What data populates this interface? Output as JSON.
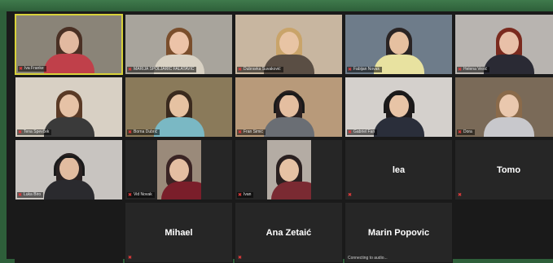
{
  "participants": [
    {
      "name": "Iva Franke",
      "type": "video",
      "active": true,
      "bg": "#8a8478",
      "skin": "#e2b9a0",
      "hair": "#4a3024",
      "shirt": "#c0404a"
    },
    {
      "name": "MARIJA SPOLJARIC FALATAVIC",
      "type": "video",
      "bg": "#a8a49c",
      "skin": "#ecc3a8",
      "hair": "#7a4e2c",
      "shirt": "#d9d2c4"
    },
    {
      "name": "Dubravka Šuvaković",
      "type": "video",
      "bg": "#c8b6a0",
      "skin": "#e8c4a4",
      "hair": "#c9a46a",
      "shirt": "#5a4e44"
    },
    {
      "name": "Fabijan Novak",
      "type": "video",
      "bg": "#6e7c8a",
      "skin": "#e6c0a0",
      "hair": "#2a2424",
      "shirt": "#e8e2a0"
    },
    {
      "name": "Helena Vesić",
      "type": "video",
      "bg": "#b8b4b0",
      "skin": "#e8c0a8",
      "hair": "#7a2a1e",
      "shirt": "#2a2a34"
    },
    {
      "name": "Tena Spevček",
      "type": "video",
      "bg": "#d8d0c4",
      "skin": "#e6c2a6",
      "hair": "#5a3a26",
      "shirt": "#3a3a3a"
    },
    {
      "name": "Borna Dubrić",
      "type": "video",
      "bg": "#8a7a5a",
      "skin": "#e6c2a2",
      "hair": "#3a2a1e",
      "shirt": "#7ab8c4"
    },
    {
      "name": "Fran Šimić",
      "type": "video",
      "bg": "#b89a7a",
      "skin": "#e4bea0",
      "hair": "#2a2020",
      "shirt": "#6a6e74",
      "headset": true
    },
    {
      "name": "Gabriel Fan",
      "type": "video",
      "bg": "#d4d0cc",
      "skin": "#e8c4a6",
      "hair": "#1e1a1a",
      "shirt": "#2a2e3a",
      "headset": true
    },
    {
      "name": "Dora",
      "type": "video",
      "bg": "#7a6a58",
      "skin": "#eac8ae",
      "hair": "#8a6a4a",
      "shirt": "#c8c8cc"
    },
    {
      "name": "Luka Biro",
      "type": "video",
      "bg": "#c8c4c0",
      "skin": "#e2bca0",
      "hair": "#2a2222",
      "shirt": "#2a2a2e",
      "headset": true
    },
    {
      "name": "Vid Novak",
      "type": "small-video",
      "bg": "#9a8a7a",
      "skin": "#e4bea2",
      "hair": "#3a2424",
      "shirt": "#7a1e2a"
    },
    {
      "name": "Ivan",
      "type": "small-video",
      "bg": "#b4aca4",
      "skin": "#e6c2a4",
      "hair": "#2a2020",
      "shirt": "#7a2a32"
    },
    {
      "name": "lea",
      "type": "name"
    },
    {
      "name": "Tomo",
      "type": "name"
    },
    {
      "name": "",
      "type": "blank"
    },
    {
      "name": "Mihael",
      "type": "name"
    },
    {
      "name": "Ana Zetaić",
      "type": "name"
    },
    {
      "name": "Marin Popovic",
      "type": "name",
      "status": "Connecting to audio..."
    }
  ]
}
